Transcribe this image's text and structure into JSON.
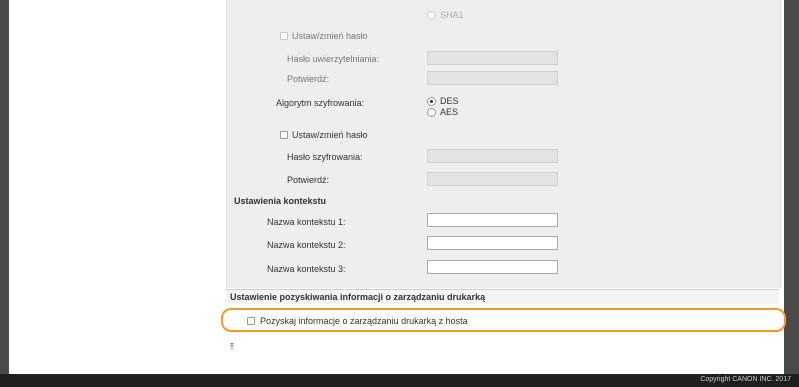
{
  "auth": {
    "sha1_label": "SHA1",
    "set_change_password_label": "Ustaw/zmień hasło",
    "auth_password_label": "Hasło uwierzytelniania:",
    "confirm_label": "Potwierdź:"
  },
  "encryption": {
    "algorithm_label": "Algorytm szyfrowania:",
    "options": [
      "DES",
      "AES"
    ],
    "selected": "DES",
    "set_change_password_label": "Ustaw/zmień hasło",
    "enc_password_label": "Hasło szyfrowania:",
    "confirm_label": "Potwierdź:"
  },
  "context": {
    "heading": "Ustawienia kontekstu",
    "fields": [
      {
        "label": "Nazwa kontekstu 1:",
        "value": ""
      },
      {
        "label": "Nazwa kontekstu 2:",
        "value": ""
      },
      {
        "label": "Nazwa kontekstu 3:",
        "value": ""
      }
    ]
  },
  "printer_mgmt": {
    "heading": "Ustawienie pozyskiwania informacji o zarządzaniu drukarką",
    "checkbox_label": "Pozyskaj informacje o zarządzaniu drukarką z hosta",
    "checked": false,
    "highlight_color": "#f29a2e"
  },
  "footer": {
    "copyright": "Copyright CANON INC. 2017"
  }
}
